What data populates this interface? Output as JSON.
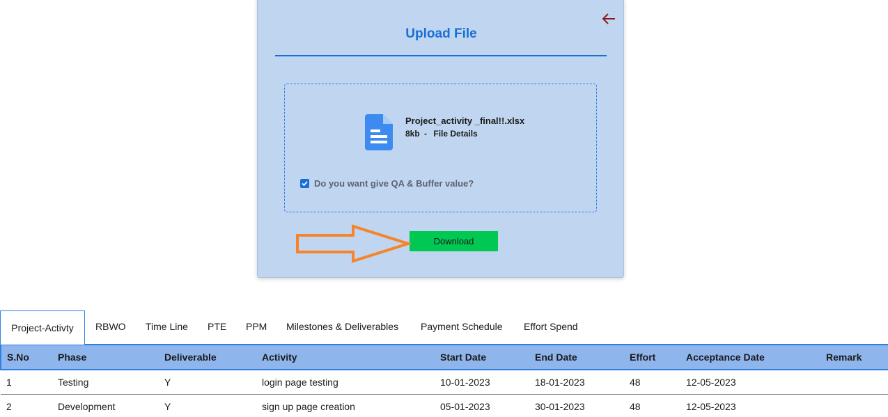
{
  "upload": {
    "title": "Upload File",
    "file_name": "Project_activity _final!!.xlsx",
    "file_size": "8kb",
    "file_sep": "-",
    "file_details": "File Details",
    "qa_label": "Do you want give QA & Buffer value?",
    "qa_checked": true,
    "download_label": "Download"
  },
  "colors": {
    "card_bg": "#c0d5f0",
    "accent": "#1a6fd6",
    "download_bg": "#00c853",
    "arrow_orange": "#f5842b",
    "back_arrow": "#8b1a1a",
    "header_bg": "#8fb5ed"
  },
  "icons": {
    "back": "arrow-left-icon",
    "file": "document-icon",
    "check": "check-icon",
    "pointer": "orange-arrow-icon"
  },
  "tabs": [
    {
      "label": "Project-Activty",
      "active": true
    },
    {
      "label": "RBWO"
    },
    {
      "label": "Time Line"
    },
    {
      "label": "PTE"
    },
    {
      "label": "PPM"
    },
    {
      "label": "Milestones & Deliverables"
    },
    {
      "label": "Payment Schedule"
    },
    {
      "label": "Effort Spend"
    }
  ],
  "table": {
    "columns": [
      "S.No",
      "Phase",
      "Deliverable",
      "Activity",
      "Start Date",
      "End Date",
      "Effort",
      "Acceptance Date",
      "Remark"
    ],
    "rows": [
      [
        "1",
        "Testing",
        "Y",
        "login page testing",
        "10-01-2023",
        "18-01-2023",
        "48",
        "12-05-2023",
        ""
      ],
      [
        "2",
        "Development",
        "Y",
        "sign up page creation",
        "05-01-2023",
        "30-01-2023",
        "48",
        "12-05-2023",
        ""
      ]
    ]
  }
}
